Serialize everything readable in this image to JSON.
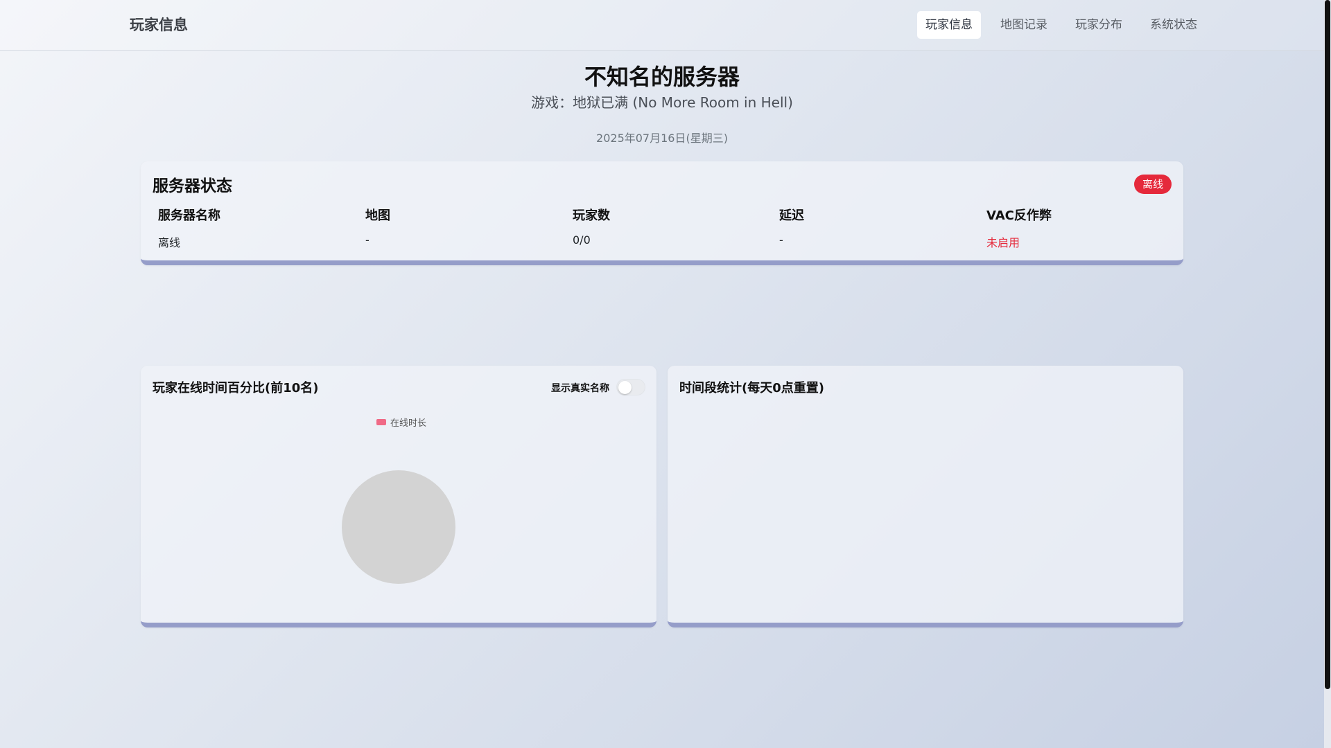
{
  "navbar": {
    "brand": "玩家信息",
    "links": [
      {
        "label": "玩家信息",
        "active": true
      },
      {
        "label": "地图记录",
        "active": false
      },
      {
        "label": "玩家分布",
        "active": false
      },
      {
        "label": "系统状态",
        "active": false
      }
    ]
  },
  "header": {
    "title": "不知名的服务器",
    "subtitle": "游戏：地狱已满 (No More Room in Hell)",
    "date": "2025年07月16日(星期三)"
  },
  "server_status": {
    "title": "服务器状态",
    "badge": "离线",
    "badge_color": "#e5293b",
    "columns": [
      {
        "header": "服务器名称",
        "value": "离线"
      },
      {
        "header": "地图",
        "value": "-"
      },
      {
        "header": "玩家数",
        "value": "0/0"
      },
      {
        "header": "延迟",
        "value": "-"
      },
      {
        "header": "VAC反作弊",
        "value": "未启用"
      }
    ]
  },
  "online_chart": {
    "title": "玩家在线时间百分比(前10名)",
    "toggle_label": "显示真实名称",
    "toggle_on": false
  },
  "time_chart": {
    "title": "时间段统计(每天0点重置)"
  },
  "chart_data": {
    "type": "pie",
    "series": [
      {
        "name": "在线时长",
        "values": []
      }
    ],
    "empty_color": "#d3d3d3",
    "series_color": "#f06a86"
  }
}
